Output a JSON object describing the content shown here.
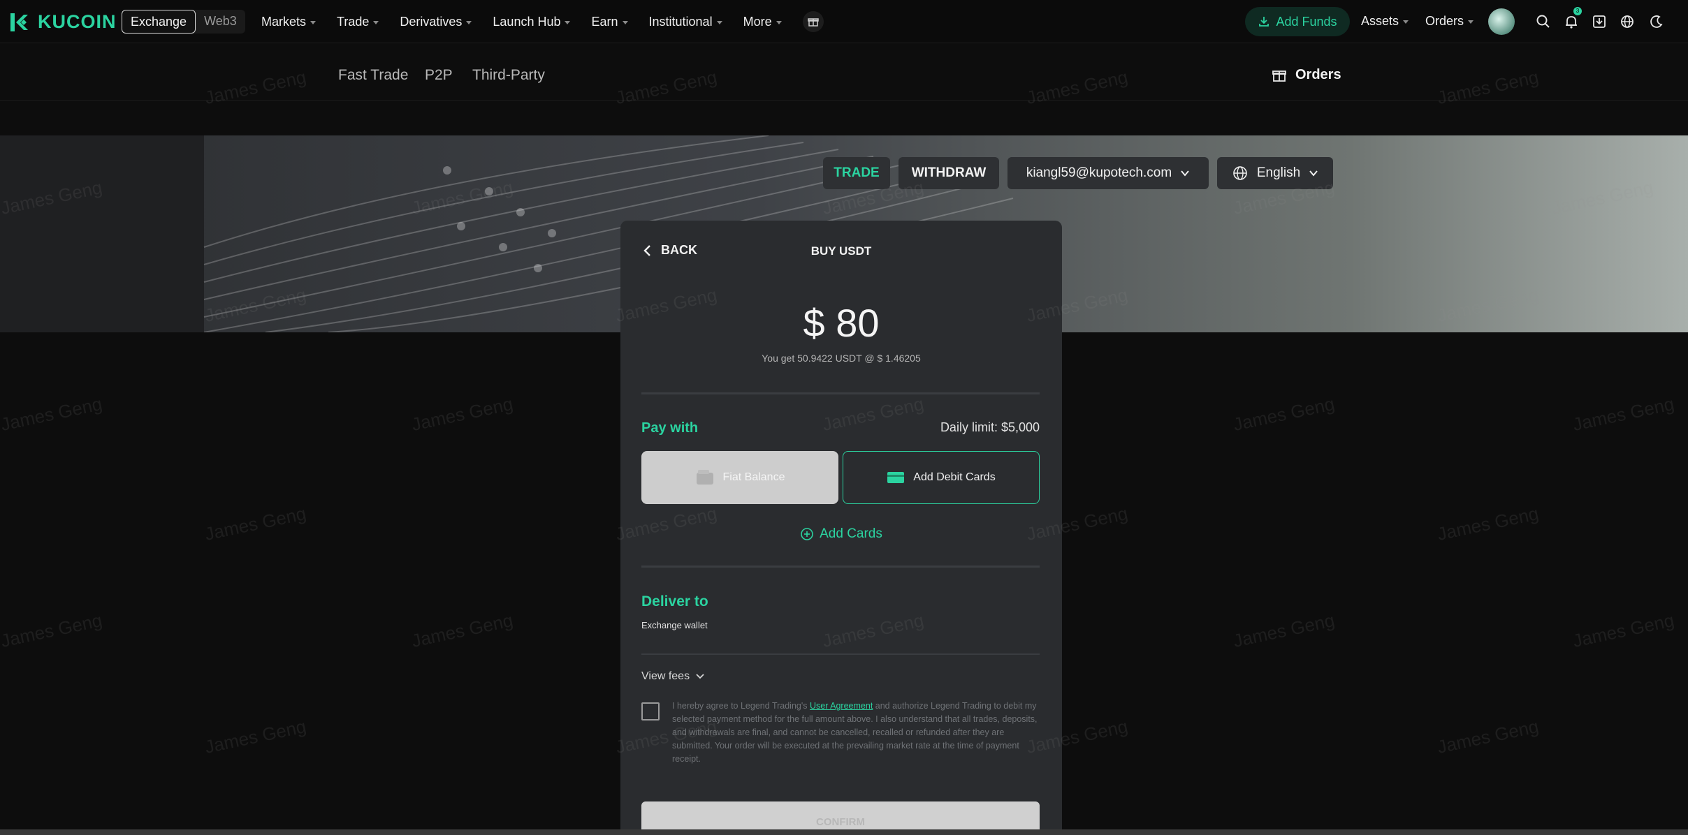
{
  "brand": {
    "name": "KUCOIN",
    "accent": "#2bd3a0"
  },
  "mode_switch": {
    "exchange": "Exchange",
    "web3": "Web3"
  },
  "menu": [
    {
      "label": "Markets"
    },
    {
      "label": "Trade"
    },
    {
      "label": "Derivatives"
    },
    {
      "label": "Launch Hub"
    },
    {
      "label": "Earn"
    },
    {
      "label": "Institutional"
    },
    {
      "label": "More"
    }
  ],
  "right_nav": {
    "add_funds": "Add Funds",
    "assets": "Assets",
    "orders": "Orders",
    "notification_count": "3"
  },
  "subnav": {
    "tabs": [
      "Fast Trade",
      "P2P",
      "Third-Party"
    ],
    "orders": "Orders"
  },
  "hero": {
    "trade": "TRADE",
    "withdraw": "WITHDRAW",
    "email": "kiangl59@kupotech.com",
    "language": "English"
  },
  "card": {
    "back": "BACK",
    "title": "BUY USDT",
    "amount": "$ 80",
    "rate": "You get 50.9422 USDT @ $ 1.46205",
    "pay_with": "Pay with",
    "daily_limit": "Daily limit: $5,000",
    "fiat_balance": "Fiat Balance",
    "add_debit_cards": "Add Debit Cards",
    "add_cards": "Add Cards",
    "deliver_to": "Deliver to",
    "wallet": "Exchange wallet",
    "view_fees": "View fees",
    "agree_prefix": "I hereby agree to Legend Trading's ",
    "agree_link": "User Agreement",
    "agree_suffix": " and authorize Legend Trading to debit my selected payment method for the full amount above. I also understand that all trades, deposits, and withdrawals are final, and cannot be cancelled, recalled or refunded after they are submitted. Your order will be executed at the prevailing market rate at the time of payment receipt.",
    "confirm": "CONFIRM"
  },
  "watermark": "James Geng"
}
